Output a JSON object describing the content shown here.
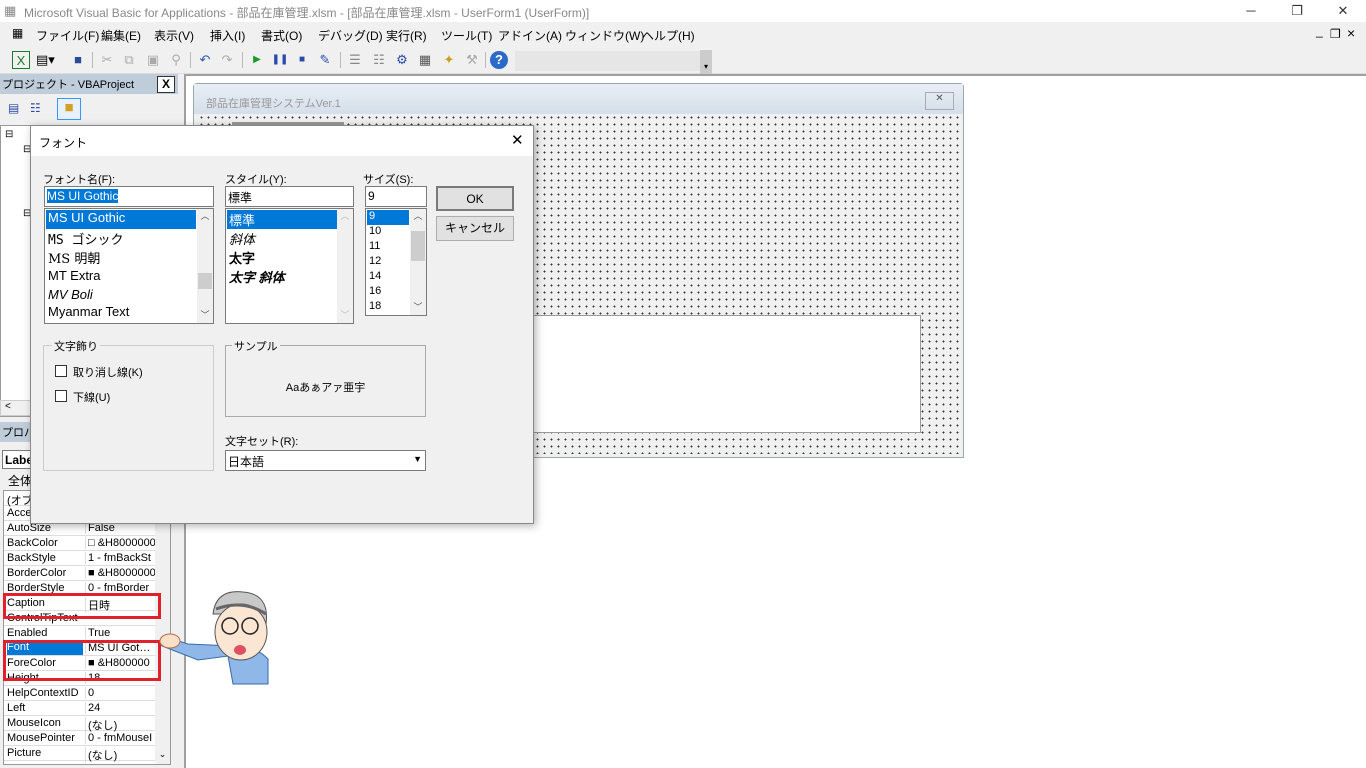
{
  "window": {
    "title": "Microsoft Visual Basic for Applications - 部品在庫管理.xlsm - [部品在庫管理.xlsm - UserForm1 (UserForm)]",
    "minimize": "─",
    "restore": "❐",
    "close": "✕"
  },
  "menu": {
    "items": [
      "ファイル(F)",
      "編集(E)",
      "表示(V)",
      "挿入(I)",
      "書式(O)",
      "デバッグ(D)",
      "実行(R)",
      "ツール(T)",
      "アドイン(A)",
      "ウィンドウ(W)",
      "ヘルプ(H)"
    ],
    "mdi": [
      "_",
      "❐",
      "×"
    ]
  },
  "toolbar": {
    "icons": [
      "excel-icon",
      "insert-userform-icon",
      "save-icon",
      "cut-icon",
      "copy-icon",
      "paste-icon",
      "find-icon",
      "undo-icon",
      "redo-icon",
      "run-icon",
      "break-icon",
      "reset-icon",
      "design-mode-icon",
      "project-explorer-icon",
      "properties-icon",
      "object-browser-icon",
      "toolbox-icon",
      "help-icon"
    ]
  },
  "project": {
    "title": "プロジェクト - VBAProject",
    "close": "X"
  },
  "properties": {
    "title": "プロパティ",
    "object": "Label",
    "tab": "全体",
    "rows": [
      [
        "(オブジェクト名)",
        ""
      ],
      [
        "Accelerator",
        ""
      ],
      [
        "AutoSize",
        "False"
      ],
      [
        "BackColor",
        "□ &H8000000"
      ],
      [
        "BackStyle",
        "1 - fmBackSt"
      ],
      [
        "BorderColor",
        "■ &H8000000"
      ],
      [
        "BorderStyle",
        "0 - fmBorder"
      ],
      [
        "Caption",
        "日時"
      ],
      [
        "ControlTipText",
        ""
      ],
      [
        "Enabled",
        "True"
      ],
      [
        "Font",
        "MS UI Got…"
      ],
      [
        "ForeColor",
        "■ &H800000"
      ],
      [
        "Height",
        "18"
      ],
      [
        "HelpContextID",
        "0"
      ],
      [
        "Left",
        "24"
      ],
      [
        "MouseIcon",
        "(なし)"
      ],
      [
        "MousePointer",
        "0 - fmMouseI"
      ],
      [
        "Picture",
        "(なし)"
      ]
    ]
  },
  "userform": {
    "title": "部品在庫管理システムVer.1",
    "close": "✕"
  },
  "font_dialog": {
    "title": "フォント",
    "close": "✕",
    "font_label": "フォント名(F):",
    "font_value": "MS UI Gothic",
    "fonts": [
      "MS UI Gothic",
      "MS ゴシック",
      "MS 明朝",
      "MT Extra",
      "MV Boli",
      "Myanmar Text"
    ],
    "style_label": "スタイル(Y):",
    "style_value": "標準",
    "styles": [
      "標準",
      "斜体",
      "太字",
      "太字 斜体"
    ],
    "size_label": "サイズ(S):",
    "size_value": "9",
    "sizes": [
      "9",
      "10",
      "11",
      "12",
      "14",
      "16",
      "18"
    ],
    "ok": "OK",
    "cancel": "キャンセル",
    "effects_label": "文字飾り",
    "strikeout": "取り消し線(K)",
    "underline": "下線(U)",
    "sample_label": "サンプル",
    "sample_text": "Aaあぁアァ亜宇",
    "charset_label": "文字セット(R):",
    "charset_value": "日本語"
  },
  "colors": {
    "highlight": "#0078d7",
    "annotation": "#e0202a"
  }
}
